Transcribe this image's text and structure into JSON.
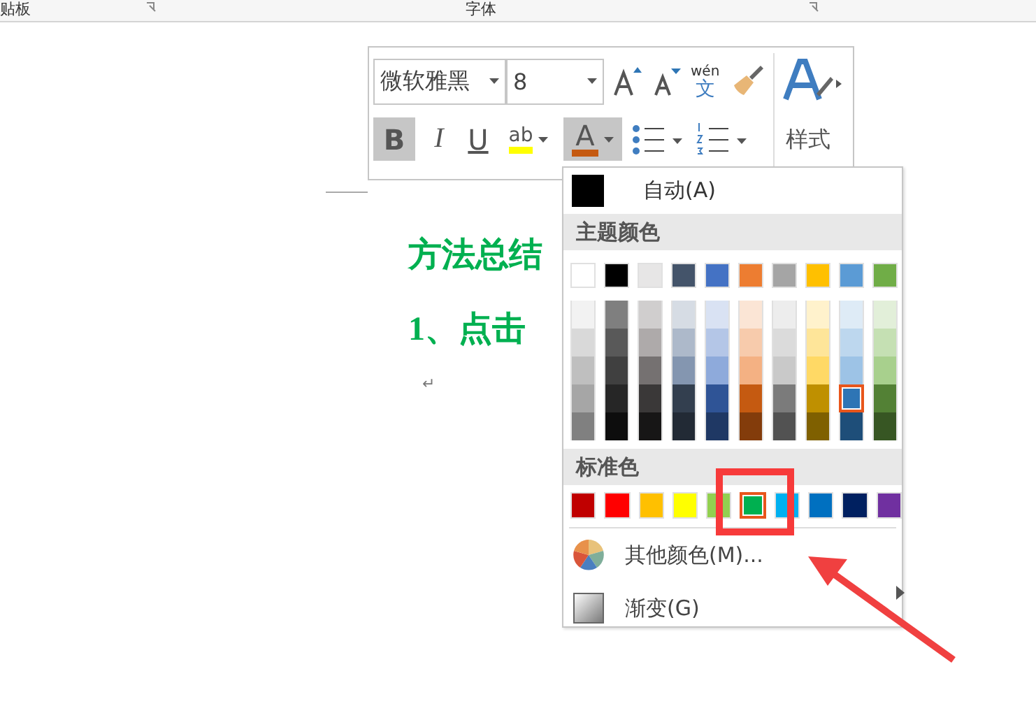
{
  "ribbon": {
    "groups": [
      {
        "label": "贴板"
      },
      {
        "label": "字体"
      }
    ]
  },
  "document": {
    "heading": "方法总结",
    "step": "1、点击",
    "paragraph_mark": "↵"
  },
  "mini_toolbar": {
    "font": "微软雅黑",
    "size": "8",
    "phonetic": {
      "top": "wén",
      "bottom": "文"
    },
    "styles_label": "样式",
    "format_buttons": [
      {
        "kind": "bold",
        "label": "B",
        "pressed": true
      },
      {
        "kind": "italic",
        "label": "I",
        "pressed": false
      },
      {
        "kind": "underline",
        "label": "U",
        "pressed": false
      },
      {
        "kind": "highlight",
        "label": "ab",
        "pressed": false,
        "color": "#ffff00"
      },
      {
        "kind": "fontcolor",
        "label": "A",
        "pressed": true,
        "color": "#c55a11"
      },
      {
        "kind": "bullets"
      },
      {
        "kind": "numbering"
      }
    ]
  },
  "color_menu": {
    "auto": {
      "label": "自动(A)"
    },
    "theme_header": "主题颜色",
    "theme_colors": [
      {
        "color": "#ffffff",
        "selected": false
      },
      {
        "color": "#000000",
        "selected": false
      },
      {
        "color": "#e7e6e6",
        "selected": false
      },
      {
        "color": "#44546a",
        "selected": false
      },
      {
        "color": "#4472c4",
        "selected": false
      },
      {
        "color": "#ed7d31",
        "selected": false
      },
      {
        "color": "#a5a5a5",
        "selected": false
      },
      {
        "color": "#ffc000",
        "selected": false
      },
      {
        "color": "#5b9bd5",
        "selected": false
      },
      {
        "color": "#70ad47",
        "selected": false
      }
    ],
    "shades": [
      [
        {
          "color": "#f2f2f2",
          "selected": false
        },
        {
          "color": "#7f7f7f",
          "selected": false
        },
        {
          "color": "#d0cece",
          "selected": false
        },
        {
          "color": "#d6dce4",
          "selected": false
        },
        {
          "color": "#d9e2f3",
          "selected": false
        },
        {
          "color": "#fbe5d5",
          "selected": false
        },
        {
          "color": "#ededed",
          "selected": false
        },
        {
          "color": "#fff2cc",
          "selected": false
        },
        {
          "color": "#deebf6",
          "selected": false
        },
        {
          "color": "#e2efd9",
          "selected": false
        }
      ],
      [
        {
          "color": "#d9d9d9",
          "selected": false
        },
        {
          "color": "#595959",
          "selected": false
        },
        {
          "color": "#aeaaaa",
          "selected": false
        },
        {
          "color": "#adb9ca",
          "selected": false
        },
        {
          "color": "#b4c6e7",
          "selected": false
        },
        {
          "color": "#f7cbac",
          "selected": false
        },
        {
          "color": "#dbdbdb",
          "selected": false
        },
        {
          "color": "#fee599",
          "selected": false
        },
        {
          "color": "#bdd7ee",
          "selected": false
        },
        {
          "color": "#c5e0b3",
          "selected": false
        }
      ],
      [
        {
          "color": "#bfbfbf",
          "selected": false
        },
        {
          "color": "#404040",
          "selected": false
        },
        {
          "color": "#757171",
          "selected": false
        },
        {
          "color": "#8496b0",
          "selected": false
        },
        {
          "color": "#8eaadb",
          "selected": false
        },
        {
          "color": "#f4b183",
          "selected": false
        },
        {
          "color": "#c9c9c9",
          "selected": false
        },
        {
          "color": "#ffd965",
          "selected": false
        },
        {
          "color": "#9dc3e6",
          "selected": false
        },
        {
          "color": "#a8d08d",
          "selected": false
        }
      ],
      [
        {
          "color": "#a6a6a6",
          "selected": false
        },
        {
          "color": "#262626",
          "selected": false
        },
        {
          "color": "#3a3838",
          "selected": false
        },
        {
          "color": "#333f4f",
          "selected": false
        },
        {
          "color": "#2f5496",
          "selected": false
        },
        {
          "color": "#c55a11",
          "selected": false
        },
        {
          "color": "#7b7b7b",
          "selected": false
        },
        {
          "color": "#bf9000",
          "selected": false
        },
        {
          "color": "#2e75b5",
          "selected": true
        },
        {
          "color": "#538135",
          "selected": false
        }
      ],
      [
        {
          "color": "#808080",
          "selected": false
        },
        {
          "color": "#0d0d0d",
          "selected": false
        },
        {
          "color": "#171616",
          "selected": false
        },
        {
          "color": "#222a35",
          "selected": false
        },
        {
          "color": "#1f3864",
          "selected": false
        },
        {
          "color": "#833c0b",
          "selected": false
        },
        {
          "color": "#525252",
          "selected": false
        },
        {
          "color": "#7f6000",
          "selected": false
        },
        {
          "color": "#1e4e79",
          "selected": false
        },
        {
          "color": "#375623",
          "selected": false
        }
      ]
    ],
    "standard_header": "标准色",
    "standard_colors": [
      {
        "color": "#c00000",
        "selected": false
      },
      {
        "color": "#ff0000",
        "selected": false
      },
      {
        "color": "#ffc000",
        "selected": false
      },
      {
        "color": "#ffff00",
        "selected": false
      },
      {
        "color": "#92d050",
        "selected": false
      },
      {
        "color": "#00b050",
        "selected": true
      },
      {
        "color": "#00b0f0",
        "selected": false
      },
      {
        "color": "#0070c0",
        "selected": false
      },
      {
        "color": "#002060",
        "selected": false
      },
      {
        "color": "#7030a0",
        "selected": false
      }
    ],
    "items": [
      {
        "kind": "more",
        "label": "其他颜色(M)...",
        "submenu": false
      },
      {
        "kind": "gradient",
        "label": "渐变(G)",
        "submenu": true
      }
    ]
  }
}
